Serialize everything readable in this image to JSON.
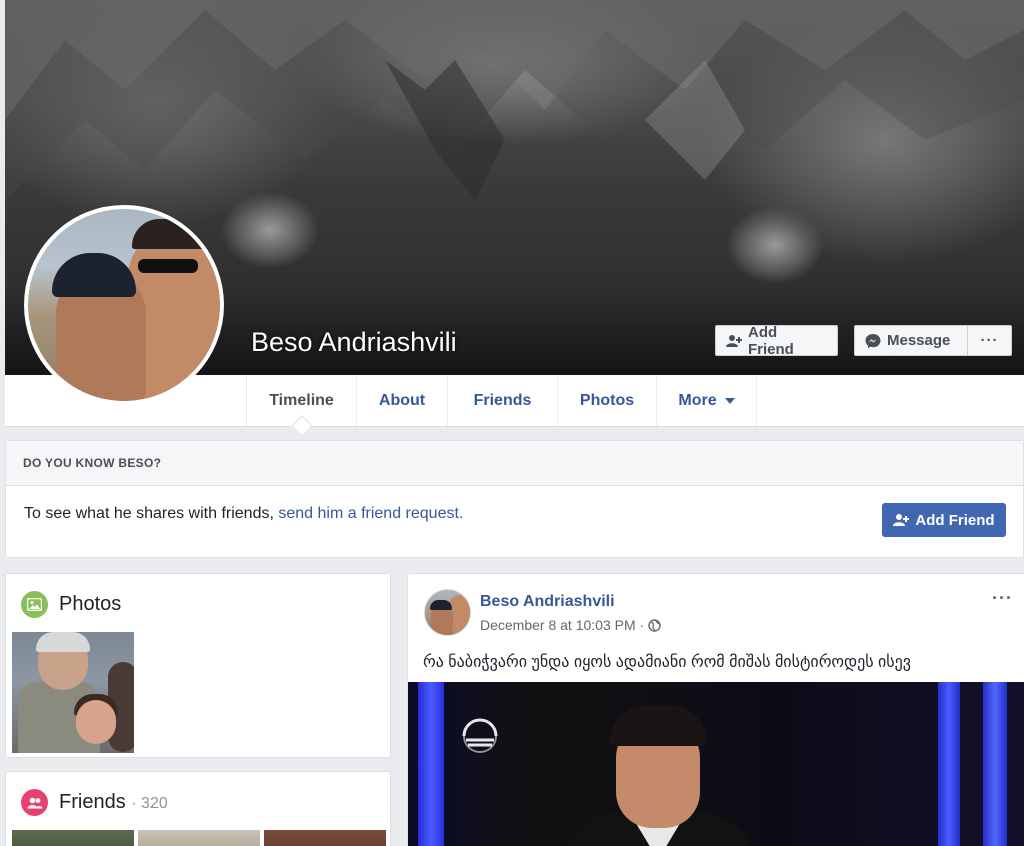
{
  "profile": {
    "name": "Beso Andriashvili"
  },
  "cover_actions": {
    "add_friend_label": "Add Friend",
    "message_label": "Message",
    "more_label": "···"
  },
  "nav": {
    "tabs": [
      {
        "label": "Timeline",
        "active": true
      },
      {
        "label": "About"
      },
      {
        "label": "Friends"
      },
      {
        "label": "Photos"
      },
      {
        "label": "More"
      }
    ]
  },
  "know_box": {
    "heading": "DO YOU KNOW BESO?",
    "text": "To see what he shares with friends, ",
    "link": "send him a friend request.",
    "button_label": "Add Friend"
  },
  "photos_card": {
    "title": "Photos"
  },
  "friends_card": {
    "title": "Friends",
    "count": "· 320"
  },
  "post": {
    "author": "Beso Andriashvili",
    "timestamp": "December 8 at 10:03 PM ·",
    "options_label": "···",
    "text": "რა ნაბიჭვარი უნდა იყოს ადამიანი რომ მიშას მისტიროდეს ისევ"
  },
  "colors": {
    "link_blue": "#365899",
    "button_blue": "#4267b2",
    "page_bg": "#e9ebee"
  }
}
